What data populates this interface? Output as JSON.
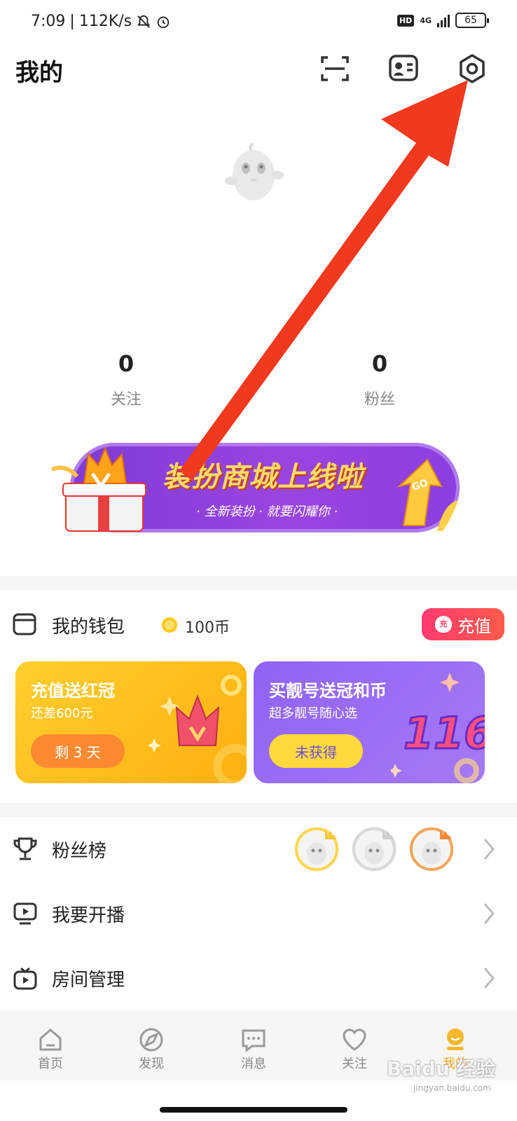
{
  "status_bar": {
    "time": "7:09",
    "separator": "|",
    "speed": "112K/s",
    "network": "4G",
    "hd": "HD",
    "battery": "65"
  },
  "header": {
    "title": "我的",
    "icons": [
      "scan-icon",
      "profile-card-icon",
      "settings-icon"
    ]
  },
  "stats": {
    "follow_count": "0",
    "follow_label": "关注",
    "fans_count": "0",
    "fans_label": "粉丝"
  },
  "banner": {
    "title": "装扮商城上线啦",
    "subtitle": "· 全新装扮 · 就要闪耀你 ·",
    "badge": "GO",
    "crown_letter": "V"
  },
  "wallet": {
    "label": "我的钱包",
    "coins": "100币",
    "recharge_label": "充值",
    "recharge_icon_text": "充",
    "cards": [
      {
        "title": "充值送红冠",
        "subtitle": "还差600元",
        "button": "剩 3 天",
        "deco": "V"
      },
      {
        "title": "买靓号送冠和币",
        "subtitle": "超多靓号随心选",
        "button": "未获得",
        "deco": "116"
      }
    ]
  },
  "menu": [
    {
      "label": "粉丝榜"
    },
    {
      "label": "我要开播"
    },
    {
      "label": "房间管理"
    }
  ],
  "tabs": [
    {
      "label": "首页"
    },
    {
      "label": "发现"
    },
    {
      "label": "消息"
    },
    {
      "label": "关注"
    },
    {
      "label": "我的"
    }
  ],
  "watermark": {
    "text": "Baidu 经验",
    "sub": "jingyan.baidu.com"
  },
  "colors": {
    "accent": "#f5a623",
    "recharge": "#ff3b70",
    "arrow": "#f0391f",
    "banner": "#8b3fe0"
  }
}
